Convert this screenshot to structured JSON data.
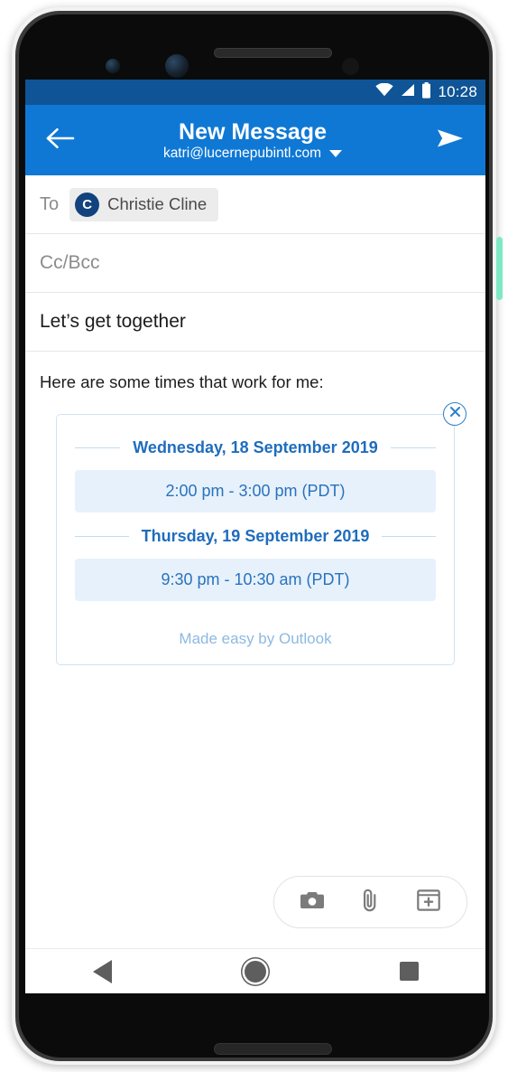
{
  "status_bar": {
    "time": "10:28",
    "icons": [
      "wifi-icon",
      "cellular-signal-icon",
      "battery-icon"
    ],
    "background": "#0f5496"
  },
  "app_bar": {
    "title": "New Message",
    "account": "katri@lucernepubintl.com",
    "back_icon": "back-arrow-icon",
    "send_icon": "send-icon",
    "account_dropdown_icon": "chevron-down-icon",
    "background": "#0f78d4"
  },
  "compose": {
    "to_label": "To",
    "recipients": [
      {
        "initial": "C",
        "name": "Christie Cline",
        "avatar_color": "#12437e"
      }
    ],
    "cc_bcc_placeholder": "Cc/Bcc",
    "subject": "Let’s get together",
    "body_text": "Here are some times that work for me:"
  },
  "scheduling_card": {
    "close_icon": "close-icon",
    "days": [
      {
        "date_label": "Wednesday, 18 September 2019",
        "slots": [
          "2:00 pm - 3:00 pm (PDT)"
        ]
      },
      {
        "date_label": "Thursday, 19 September 2019",
        "slots": [
          "9:30 pm - 10:30 am (PDT)"
        ]
      }
    ],
    "footer": "Made easy by Outlook",
    "accent_color": "#1f6dbd",
    "slot_background": "#e7f1fb",
    "border_color": "#cfe3f5"
  },
  "attachment_bar": {
    "buttons": [
      {
        "name": "camera-button",
        "icon": "camera-icon"
      },
      {
        "name": "attach-file-button",
        "icon": "paperclip-icon"
      },
      {
        "name": "add-item-button",
        "icon": "calendar-plus-icon"
      }
    ]
  },
  "nav_bar": {
    "buttons": [
      {
        "name": "android-back-button",
        "icon": "triangle-back-icon"
      },
      {
        "name": "android-home-button",
        "icon": "circle-home-icon"
      },
      {
        "name": "android-recents-button",
        "icon": "square-recents-icon"
      }
    ]
  },
  "device": {
    "side_button_color": "#7fe9c4"
  }
}
